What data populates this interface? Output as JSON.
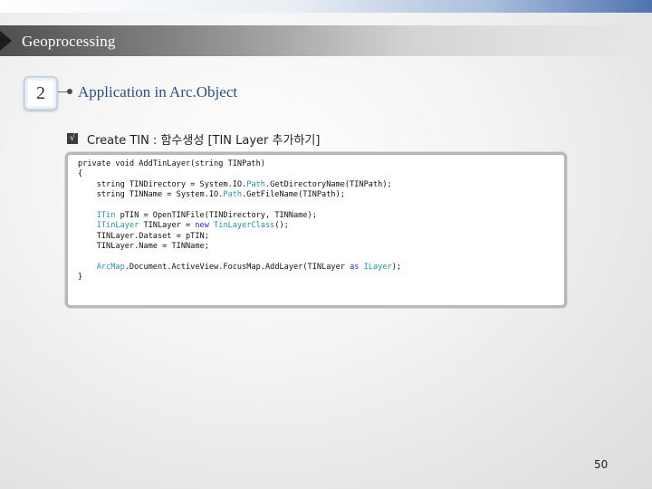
{
  "header": {
    "title": "Geoprocessing"
  },
  "section": {
    "number": "2",
    "heading": "Application in Arc.Object"
  },
  "subsection": {
    "check": "√",
    "label": "Create TIN : 함수생성 [TIN Layer 추가하기]"
  },
  "code": {
    "lines": [
      [
        [
          "private void AddTinLayer(string TINPath)",
          ""
        ]
      ],
      [
        [
          "{",
          ""
        ]
      ],
      [
        [
          "    string TINDirectory = System.IO.",
          ""
        ],
        [
          "Path",
          "ty"
        ],
        [
          ".GetDirectoryName(TINPath);",
          ""
        ]
      ],
      [
        [
          "    string TINName = System.IO.",
          ""
        ],
        [
          "Path",
          "ty"
        ],
        [
          ".GetFileName(TINPath);",
          ""
        ]
      ],
      [
        [
          "",
          ""
        ]
      ],
      [
        [
          "    ",
          ""
        ],
        [
          "ITin",
          "ty"
        ],
        [
          " pTIN = OpenTINFile(TINDirectory, TINName);",
          ""
        ]
      ],
      [
        [
          "    ",
          ""
        ],
        [
          "ITinLayer",
          "ty"
        ],
        [
          " TINLayer = ",
          ""
        ],
        [
          "new",
          "kw"
        ],
        [
          " ",
          ""
        ],
        [
          "TinLayerClass",
          "ty"
        ],
        [
          "();",
          ""
        ]
      ],
      [
        [
          "    TINLayer.Dataset = pTIN;",
          ""
        ]
      ],
      [
        [
          "    TINLayer.Name = TINName;",
          ""
        ]
      ],
      [
        [
          "",
          ""
        ]
      ],
      [
        [
          "    ",
          ""
        ],
        [
          "ArcMap",
          "ty"
        ],
        [
          ".Document.ActiveView.FocusMap.AddLayer(TINLayer ",
          ""
        ],
        [
          "as",
          "kw"
        ],
        [
          " ",
          ""
        ],
        [
          "ILayer",
          "ty"
        ],
        [
          ");",
          ""
        ]
      ],
      [
        [
          "}",
          ""
        ]
      ]
    ]
  },
  "footer": {
    "page_number": "50"
  }
}
